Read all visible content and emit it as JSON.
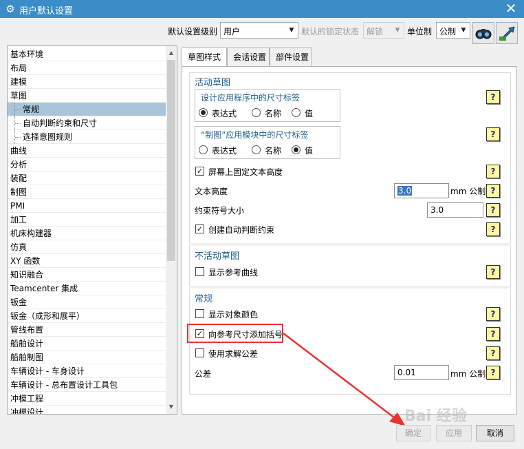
{
  "window": {
    "title": "用户默认设置",
    "close_label": "✕"
  },
  "toolbar": {
    "level_label": "默认设置级别",
    "level_value": "用户",
    "lock_label": "默认的锁定状态",
    "lock_value": "解锁",
    "unit_label": "单位制",
    "unit_value": "公制",
    "icons": [
      "binoculars-icon",
      "arrow-settings-icon"
    ]
  },
  "tree": {
    "items": [
      {
        "label": "基本环境",
        "level": 0
      },
      {
        "label": "布局",
        "level": 0
      },
      {
        "label": "建模",
        "level": 0
      },
      {
        "label": "草图",
        "level": 0
      },
      {
        "label": "常规",
        "level": 1,
        "selected": true
      },
      {
        "label": "自动判断约束和尺寸",
        "level": 1
      },
      {
        "label": "选择意图规则",
        "level": 1
      },
      {
        "label": "曲线",
        "level": 0
      },
      {
        "label": "分析",
        "level": 0
      },
      {
        "label": "装配",
        "level": 0
      },
      {
        "label": "制图",
        "level": 0
      },
      {
        "label": "PMI",
        "level": 0
      },
      {
        "label": "加工",
        "level": 0
      },
      {
        "label": "机床构建器",
        "level": 0
      },
      {
        "label": "仿真",
        "level": 0
      },
      {
        "label": "XY 函数",
        "level": 0
      },
      {
        "label": "知识融合",
        "level": 0
      },
      {
        "label": "Teamcenter 集成",
        "level": 0
      },
      {
        "label": "钣金",
        "level": 0
      },
      {
        "label": "钣金（成形和展平）",
        "level": 0
      },
      {
        "label": "管线布置",
        "level": 0
      },
      {
        "label": "船舶设计",
        "level": 0
      },
      {
        "label": "船舶制图",
        "level": 0
      },
      {
        "label": "车辆设计 - 车身设计",
        "level": 0
      },
      {
        "label": "车辆设计 - 总布置设计工具包",
        "level": 0
      },
      {
        "label": "冲模工程",
        "level": 0
      },
      {
        "label": "冲模设计",
        "level": 0
      }
    ]
  },
  "tabs": [
    {
      "label": "草图样式",
      "active": true
    },
    {
      "label": "会话设置",
      "active": false
    },
    {
      "label": "部件设置",
      "active": false
    }
  ],
  "active_sketch": {
    "title": "活动草图",
    "app_dim_group": {
      "title": "设计应用程序中的尺寸标签",
      "options": [
        "表达式",
        "名称",
        "值"
      ],
      "selected": "表达式"
    },
    "drafting_dim_group": {
      "title": "“制图”应用模块中的尺寸标签",
      "options": [
        "表达式",
        "名称",
        "值"
      ],
      "selected": "值"
    },
    "fix_text_height": {
      "label": "屏幕上固定文本高度",
      "checked": true
    },
    "text_height": {
      "label": "文本高度",
      "value": "3.0",
      "unit": "mm 公制"
    },
    "constraint_symbol_size": {
      "label": "约束符号大小",
      "value": "3.0"
    },
    "create_auto_constraints": {
      "label": "创建自动判断约束",
      "checked": true
    }
  },
  "inactive_sketch": {
    "title": "不活动草图",
    "show_ref_curves": {
      "label": "显示参考曲线",
      "checked": false
    }
  },
  "general": {
    "title": "常规",
    "show_object_color": {
      "label": "显示对象颜色",
      "checked": false
    },
    "add_parentheses": {
      "label": "向参考尺寸添加括号",
      "checked": true
    },
    "use_solve_tolerance": {
      "label": "使用求解公差",
      "checked": false
    },
    "tolerance": {
      "label": "公差",
      "value": "0.01",
      "unit": "mm 公制"
    }
  },
  "help_label": "?",
  "check_mark": "✓",
  "buttons": {
    "ok": "确定",
    "apply": "应用",
    "cancel": "取消"
  },
  "watermark": "Bai 经验",
  "colors": {
    "titlebar": "#3a8dc7",
    "highlight_box": "#e8332f",
    "section_title": "#1b5f8f",
    "tree_selected": "#a9c5dc"
  }
}
